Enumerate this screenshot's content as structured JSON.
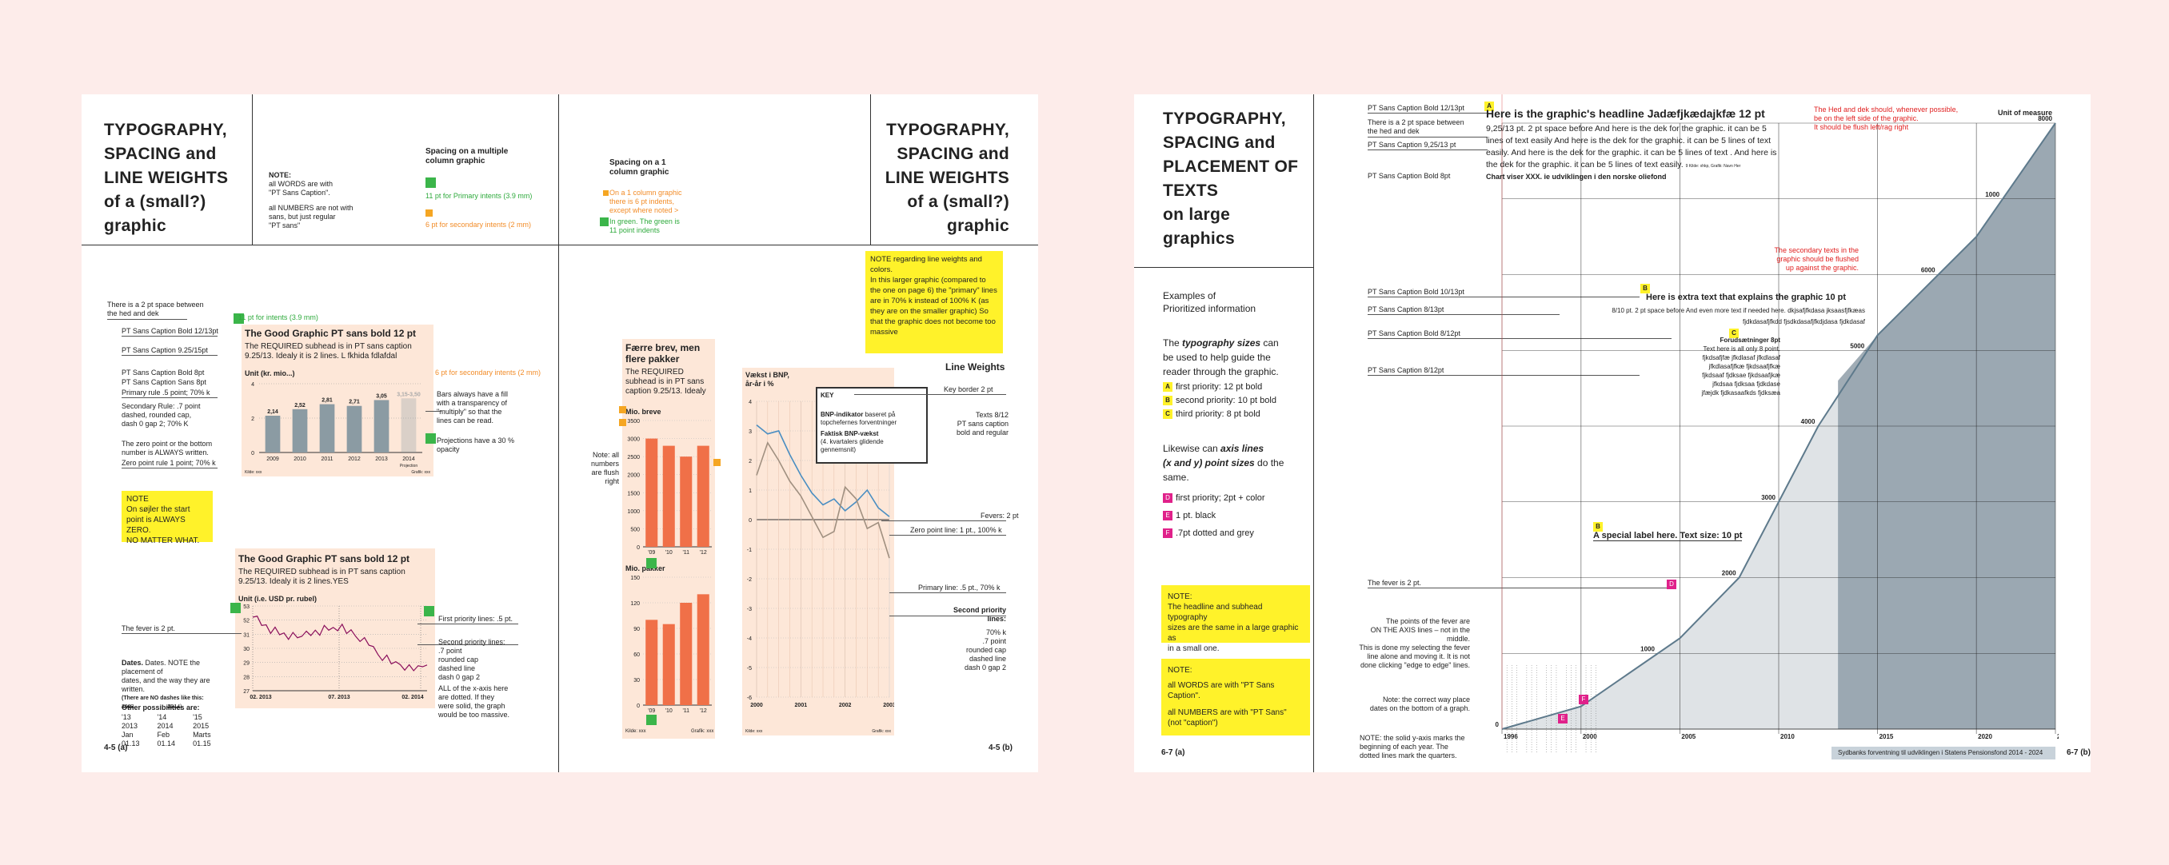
{
  "left_spread": {
    "title_left": [
      "TYPOGRAPHY,",
      "SPACING and",
      "LINE WEIGHTS",
      "of a (small?)",
      "graphic"
    ],
    "title_right": [
      "TYPOGRAPHY,",
      "SPACING and",
      "LINE WEIGHTS",
      "of a (small?)",
      "graphic"
    ],
    "note_words": [
      "NOTE:",
      "all WORDS are with",
      "\"PT Sans Caption\"."
    ],
    "note_numbers": [
      "all NUMBERS are not with",
      "sans, but just regular",
      "\"PT sans\""
    ],
    "spacing_multi_title": [
      "Spacing on a multiple",
      "column graphic"
    ],
    "spacing_multi_green": "11 pt for Primary intents (3.9 mm)",
    "spacing_multi_orange": "6 pt for secondary intents (2 mm)",
    "spacing_one_title": [
      "Spacing on a 1",
      "column graphic"
    ],
    "spacing_one_orange": [
      "On a 1 column graphic",
      "there is 6 pt indents,",
      "except where noted >"
    ],
    "spacing_one_green": [
      "In green. The green is",
      "11 point indents"
    ],
    "page_left": "4-5 (a)",
    "page_right": "4-5 (b)",
    "chart1": {
      "leaders": [
        "There is a 2 pt space between",
        "the hed and dek",
        "PT Sans Caption Bold 12/13pt",
        "PT Sans Caption 9.25/15pt",
        "PT Sans Caption Bold 8pt",
        "PT Sans Caption Sans 8pt",
        "Primary rule .5 point; 70% k",
        "Secondary Rule: .7 point",
        "dashed, rounded cap,",
        "dash 0 gap 2; 70% K",
        "The zero point or the bottom",
        "number is ALWAYS written.",
        "Zero point rule 1 point; 70% k"
      ],
      "green_label": "11 pt for intents (3.9 mm)",
      "orange_label": "6 pt for secondary intents (2 mm)",
      "hed": "The Good Graphic PT sans bold 12 pt",
      "dek": [
        "The REQUIRED subhead is in PT sans caption",
        "9.25/13. Idealy it is 2 lines. L fkhida fdlafdal"
      ],
      "unit": "Unit (kr. mio...)",
      "right_notes": [
        "Bars always have a fill",
        "with a transparency of",
        "\"multiply\" so that the",
        "lines can be read."
      ],
      "projection_note": [
        "Projections have a 30 %",
        "opacity"
      ],
      "yticks": [
        "4",
        "2",
        "0"
      ],
      "source_left": "Kilde: xxx",
      "source_right": "Grafik: xxx",
      "proj_label": "Projection"
    },
    "yellow_note": [
      "NOTE",
      "On søjler the start",
      "point is ALWAYS ZERO.",
      "NO MATTER WHAT."
    ],
    "chart_bottom": {
      "hed": "The Good Graphic PT sans bold 12 pt",
      "dek": [
        "The REQUIRED subhead is in PT sans caption",
        "9.25/13. Idealy it is 2 lines.YES"
      ],
      "unit": "Unit (i.e. USD pr. rubel)",
      "yticks": [
        "53",
        "52",
        "31",
        "30",
        "29",
        "28",
        "27"
      ],
      "xticks": [
        "02. 2013",
        "07. 2013",
        "02. 2014"
      ],
      "left_notes": {
        "fever": "The fever is 2 pt.",
        "dates": [
          "Dates. NOTE the placement of",
          "dates, and the way they are",
          "written."
        ],
        "struck": [
          "(There are NO dashes like this:",
          "2013",
          "2014)"
        ],
        "other": "Other possibilities are:",
        "cols": [
          [
            "'13",
            "2013",
            "Jan",
            "01.13"
          ],
          [
            "'14",
            "2014",
            "Feb",
            "01.14"
          ],
          [
            "'15",
            "2015",
            "Marts",
            "01.15"
          ]
        ]
      },
      "right_notes": {
        "first": "First priority lines: .5 pt.",
        "second": [
          "Second priority lines:",
          ".7 point",
          "rounded cap",
          "dashed line",
          "dash 0 gap 2"
        ],
        "xaxis": [
          "ALL of the x-axis here",
          "are dotted. If they",
          "were solid, the graph",
          "would be too massive."
        ]
      }
    },
    "chart2": {
      "hed": [
        "Færre brev, men",
        "flere pakker"
      ],
      "dek": [
        "The REQUIRED",
        "subhead is in PT sans",
        "caption 9.25/13. Idealy"
      ],
      "sub1": "Mio. breve",
      "sub2": "Mio. pakker",
      "yticks1": [
        "3500",
        "3000",
        "2500",
        "2000",
        "1500",
        "1000",
        "500",
        "0"
      ],
      "yticks2": [
        "150",
        "120",
        "90",
        "60",
        "30",
        "0"
      ],
      "xticks": [
        "'09",
        "'10",
        "'11",
        "'12"
      ],
      "left_note": [
        "Note: all",
        "numbers",
        "are flush",
        "right"
      ],
      "source_left": "Kilde: xxx",
      "source_right": "Grafik: xxx"
    },
    "yellow_line_note": [
      "NOTE regarding line weights and",
      "colors.",
      "In this larger graphic (compared to",
      "the one on page 6) the \"primary\" lines",
      "are in 70% k instead of 100% K (as",
      "they are on the smaller graphic) So",
      "that the graphic does not become too",
      "massive"
    ],
    "chart3": {
      "unit": [
        "Vækst i BNP,",
        "år-år i %"
      ],
      "key_title": "KEY",
      "key1a": "BNP-indikator",
      "key1b": "baseret på",
      "key1c": "topchefernes forventninger",
      "key2a": "Faktisk BNP-vækst",
      "key2b": "(4. kvartalers glidende",
      "key2c": "gennemsnit)",
      "yticks": [
        "4",
        "3",
        "2",
        "1",
        "0",
        "-1",
        "-2",
        "-3",
        "-4",
        "-5",
        "-6"
      ],
      "xticks": [
        "2000",
        "2001",
        "2002",
        "2003"
      ],
      "source_left": "Kilde: xxx",
      "source_right": "Grafik: xxx"
    },
    "line_weights": {
      "title": "Line Weights",
      "key_border": "Key border 2 pt",
      "texts": [
        "Texts 8/12",
        "PT sans caption",
        "bold and regular"
      ],
      "fevers": "Fevers: 2 pt",
      "zero": "Zero point line: 1 pt., 100% k",
      "primary": "Primary line: .5 pt., 70% k",
      "secondary": [
        "Second priority lines:",
        "70% k",
        ".7 point",
        "rounded cap",
        "dashed line",
        "dash 0 gap 2"
      ]
    }
  },
  "right_spread": {
    "title": [
      "TYPOGRAPHY,",
      "SPACING and",
      "PLACEMENT OF",
      "TEXTS",
      "on large",
      "graphics"
    ],
    "examples": [
      "Examples of",
      "Prioritized information"
    ],
    "sizes_intro_a": "The ",
    "sizes_intro_b": "typography sizes",
    "sizes_intro_c": [
      " can",
      "be used to help guide the",
      "reader through the graphic."
    ],
    "sizes": [
      {
        "badge": "A",
        "text": "first priority: 12 pt bold"
      },
      {
        "badge": "B",
        "text": "second priority: 10 pt bold"
      },
      {
        "badge": "C",
        "text": "third priority: 8 pt bold"
      }
    ],
    "lines_intro": [
      "Likewise can ",
      "axis lines",
      "(x and y) point sizes",
      " do the",
      "same."
    ],
    "lines": [
      {
        "badge": "D",
        "text": "first priority; 2pt + color"
      },
      {
        "badge": "E",
        "text": "1 pt. black"
      },
      {
        "badge": "F",
        "text": ".7pt dotted and grey"
      }
    ],
    "note1": [
      "NOTE:",
      "The headline and subhead typography",
      "sizes are the same in a large graphic as",
      "in a small one."
    ],
    "note2": [
      "NOTE:",
      "all WORDS are with \"PT Sans Caption\".",
      "all NUMBERS are with \"PT Sans\"",
      "(not \"caption\")"
    ],
    "page_left": "6-7 (a)",
    "page_right": "6-7 (b)",
    "leaders": [
      "PT Sans Caption Bold 12/13pt",
      "There is a 2 pt space between",
      "the hed and dek",
      "PT Sans Caption 9,25/13 pt",
      "PT Sans Caption Bold 8pt",
      "PT Sans Caption Bold 10/13pt",
      "PT Sans Caption 8/13pt",
      "PT Sans Caption Bold 8/12pt",
      "PT Sans Caption 8/12pt",
      "The fever is 2 pt."
    ],
    "fever_notes": [
      "The points of the fever are",
      "ON THE AXIS lines – not in the",
      "middle.",
      "This is done my selecting the fever",
      "line alone and moving it. It is not",
      "done clicking \"edge to edge\" lines."
    ],
    "date_note": [
      "Note: the correct way place",
      "dates on the bottom of a graph."
    ],
    "yaxis_note": [
      "NOTE: the solid y-axis marks the",
      "beginning of each year. The",
      "dotted lines mark the quarters."
    ],
    "headline": "Here is the graphic's headline Jadæfjkædajkfæ 12 pt",
    "dek": [
      "9,25/13 pt. 2 pt space before And here is the dek for the graphic. it can be 5",
      "lines of text easily And here is the dek for the graphic. it can be 5 lines of text",
      "easily. And here is the dek for the graphic. it can be 5 lines of text . And here is",
      "the dek for the graphic. it can be 5 lines of text easily."
    ],
    "dek_tiny": "9 Kilde: xhkp, Grafik: Navn Her",
    "chart_label": "Chart viser XXX. ie udviklingen i den norske oliefond",
    "red_note": [
      "The Hed and dek should, whenever possible,",
      "be on the left side of the graphic.",
      "It should be flush left/rag right"
    ],
    "unit_measure": "Unit of measure",
    "red_note2": [
      "The secondary texts in the",
      "graphic should be flushed",
      "up against the graphic."
    ],
    "extra_text": "Here is extra text that explains the graphic 10 pt",
    "extra_small": [
      "8/10 pt. 2 pt space before And even more text if needed here. dkjsafjfkdasa jksaasfjfkæas",
      "fjdkdasafjfkdd fjsdkdasafjfkdjdasa fjdkdasaf"
    ],
    "forud_title": "Forudsætninger 8pt",
    "forud_text": [
      "Text here is all only 8 point.",
      "fjkdsafjfæ jfkdlasaf jfkdlasaf",
      "jfkdlasafjfkæ fjkdsaafjfkæ",
      "fjkdsaaf fjdksae fjkdsaafjkæ",
      "jfkdsaa fjdksaa fjdkdase",
      "jfæjdk fjdkasaafkds fjdksæa"
    ],
    "special_label": "A special label here. Text size:  10 pt",
    "yticks": [
      "0",
      "1000",
      "2000",
      "3000",
      "4000",
      "5000",
      "6000",
      "1000",
      "8000"
    ],
    "xticks": [
      "1996",
      "2000",
      "2005",
      "2010",
      "2015",
      "2020",
      "2024"
    ],
    "source_bar": "Sydbanks forventning til udviklingen i Statens Pensionsfond 2014 - 2024",
    "chart_data": {
      "type": "area",
      "x": [
        1996,
        2000,
        2005,
        2008,
        2010,
        2012,
        2015,
        2020,
        2024
      ],
      "values": [
        0,
        300,
        1200,
        2000,
        3000,
        4000,
        5200,
        6500,
        8000
      ],
      "projection_from": 2013
    }
  },
  "colors": {
    "background": "#fdecea",
    "green": "#3bb54a",
    "orange": "#f5a623",
    "yellow": "#fff22a",
    "bar_grey": "#8b9ba3",
    "bar_orange": "#f07048",
    "panel": "#fde7d8",
    "magenta": "#e0218a",
    "area_grey": "#c5ccd2",
    "projection": "#8f9ea8"
  },
  "chart_data": [
    {
      "type": "bar",
      "title": "The Good Graphic PT sans bold 12 pt",
      "categories": [
        "2009",
        "2010",
        "2011",
        "2012",
        "2013",
        "2014"
      ],
      "values": [
        2.14,
        2.52,
        2.81,
        2.71,
        3.05,
        3.15
      ],
      "value_labels": [
        "2,14",
        "2,52",
        "2,81",
        "2,71",
        "3,05",
        "3,15-3,50"
      ],
      "ylabel": "Unit (kr. mio...)",
      "ylim": [
        0,
        4
      ]
    },
    {
      "type": "bar",
      "title": "Mio. breve",
      "categories": [
        "'09",
        "'10",
        "'11",
        "'12"
      ],
      "values": [
        3000,
        2800,
        2500,
        2800
      ],
      "ylim": [
        0,
        3500
      ]
    },
    {
      "type": "bar",
      "title": "Mio. pakker",
      "categories": [
        "'09",
        "'10",
        "'11",
        "'12"
      ],
      "values": [
        100,
        95,
        120,
        130
      ],
      "ylim": [
        0,
        150
      ]
    },
    {
      "type": "line",
      "title": "",
      "x": [
        2000,
        2000.25,
        2000.5,
        2000.75,
        2001,
        2001.25,
        2001.5,
        2001.75,
        2002,
        2002.25,
        2002.5,
        2002.75,
        2003
      ],
      "series": [
        {
          "name": "BNP-indikator",
          "values": [
            3.2,
            2.9,
            3.0,
            2.2,
            1.5,
            0.9,
            0.5,
            0.7,
            0.3,
            0.6,
            1.0,
            0.4,
            0.1
          ]
        },
        {
          "name": "Faktisk BNP-vækst",
          "values": [
            1.5,
            2.6,
            2.0,
            1.3,
            0.8,
            0.1,
            -0.6,
            -0.4,
            1.1,
            0.7,
            -0.3,
            -0.1,
            -1.3
          ]
        }
      ],
      "ylim": [
        -6,
        4
      ]
    }
  ]
}
